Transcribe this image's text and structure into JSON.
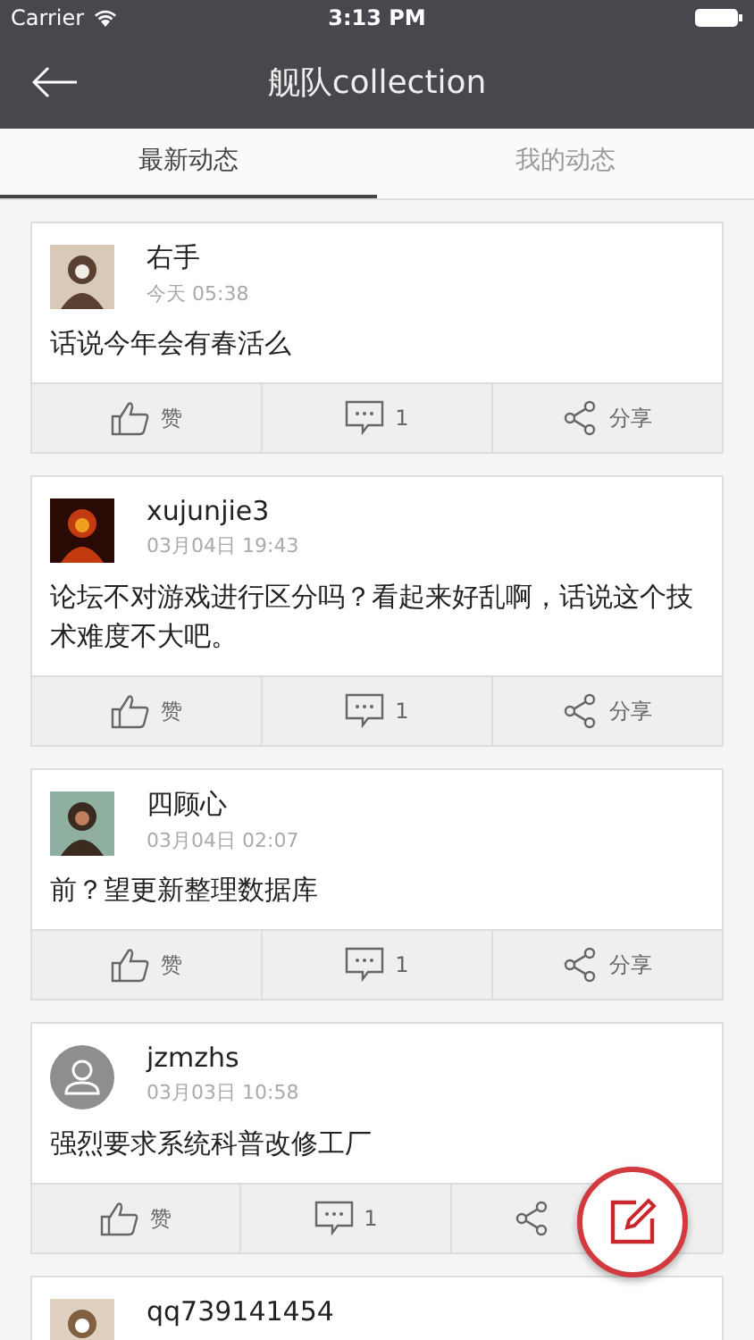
{
  "status_bar": {
    "carrier": "Carrier",
    "time": "3:13 PM"
  },
  "nav": {
    "title": "舰队collection"
  },
  "tabs": [
    {
      "label": "最新动态",
      "selected": true
    },
    {
      "label": "我的动态",
      "selected": false
    }
  ],
  "posts": [
    {
      "kind": "picture",
      "name": "右手",
      "time": "今天 05:38",
      "text": "话说今年会有春活么",
      "like": "赞",
      "comments": "1",
      "share": "分享"
    },
    {
      "kind": "picture",
      "name": "xujunjie3",
      "time": "03月04日 19:43",
      "text": "论坛不对游戏进行区分吗？看起来好乱啊，话说这个技术难度不大吧。",
      "like": "赞",
      "comments": "1",
      "share": "分享"
    },
    {
      "kind": "picture",
      "name": "四顾心",
      "time": "03月04日 02:07",
      "text": "前？望更新整理数据库",
      "like": "赞",
      "comments": "1",
      "share": "分享"
    },
    {
      "kind": "default",
      "name": "jzmzhs",
      "time": "03月03日 10:58",
      "text": "强烈要求系统科普改修工厂",
      "like": "赞",
      "comments": "1"
    },
    {
      "kind": "picture",
      "name": "qq739141454"
    }
  ]
}
